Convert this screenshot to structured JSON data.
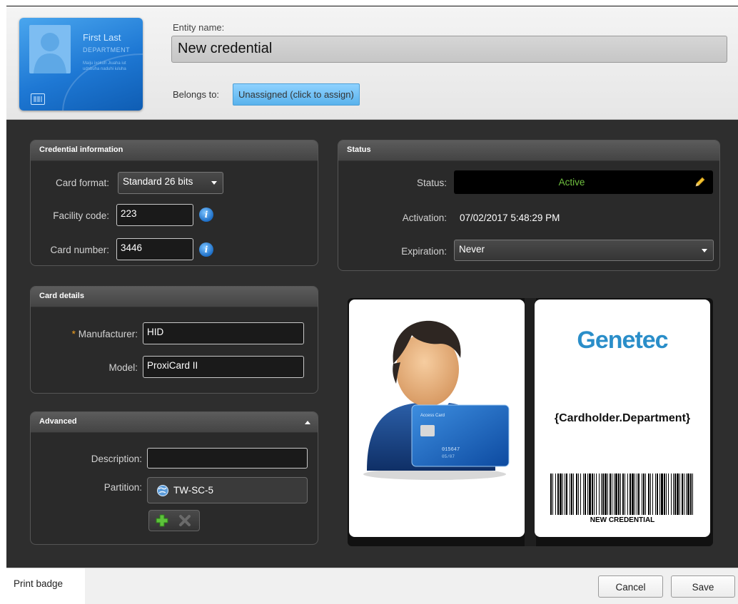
{
  "header": {
    "card_thumb": {
      "name": "First Last",
      "department": "DEPARTMENT",
      "fine_print": "Maiju ixokuh Jiuaha iut udnbuha naduhi iuluha"
    },
    "entity_label": "Entity name:",
    "entity_value": "New credential",
    "belongs_label": "Belongs to:",
    "belongs_value": "Unassigned (click to assign)"
  },
  "credential_info": {
    "title": "Credential information",
    "card_format_label": "Card format:",
    "card_format_value": "Standard 26 bits",
    "facility_code_label": "Facility code:",
    "facility_code_value": "223",
    "card_number_label": "Card number:",
    "card_number_value": "3446",
    "info_glyph": "i"
  },
  "status_panel": {
    "title": "Status",
    "status_label": "Status:",
    "status_value": "Active",
    "status_color": "#6fbf3f",
    "activation_label": "Activation:",
    "activation_value": "07/02/2017 5:48:29 PM",
    "expiration_label": "Expiration:",
    "expiration_value": "Never"
  },
  "card_details": {
    "title": "Card details",
    "required_mark": "*",
    "manufacturer_label": "Manufacturer:",
    "manufacturer_value": "HID",
    "model_label": "Model:",
    "model_value": "ProxiCard II"
  },
  "advanced": {
    "title": "Advanced",
    "description_label": "Description:",
    "description_value": "",
    "partition_label": "Partition:",
    "partition_value": "TW-SC-5"
  },
  "badge_preview": {
    "front_card": {
      "label": "Access Card",
      "number": "015647",
      "expiry": "05/07"
    },
    "logo_text": "Genetec",
    "department_field": "{Cardholder.Department}",
    "barcode_text": "NEW CREDENTIAL"
  },
  "footer": {
    "print_badge": "Print badge",
    "cancel": "Cancel",
    "save": "Save"
  },
  "icons": {
    "pencil": "pencil-icon",
    "info": "info-icon",
    "globe": "globe-icon",
    "add": "add-icon",
    "remove": "remove-icon",
    "collapse": "chevron-up-icon"
  }
}
